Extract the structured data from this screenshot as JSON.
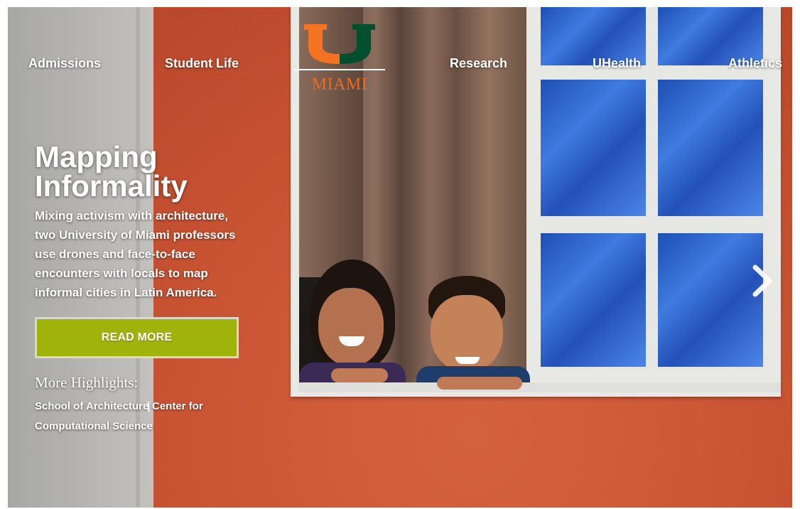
{
  "nav": {
    "left": [
      {
        "label": "Admissions"
      },
      {
        "label": "Student Life"
      }
    ],
    "right": [
      {
        "label": "Research"
      },
      {
        "label": "UHealth"
      },
      {
        "label": "Athletics"
      }
    ]
  },
  "logo": {
    "text": "MIAMI",
    "colors": {
      "orange": "#f47321",
      "green": "#005030",
      "wordmark": "#e86d1f"
    }
  },
  "feature": {
    "headline": "Mapping Informality",
    "description": "Mixing activism with architecture, two University of Miami professors use drones and face-to-face encounters with locals to map informal cities in Latin America.",
    "cta_label": "READ MORE",
    "cta_color": "#9fb30b"
  },
  "highlights": {
    "title": "More Highlights:",
    "separator": "|",
    "links": [
      {
        "label": "School of Architecture"
      },
      {
        "label": "Center for"
      },
      {
        "label": "Computational Science"
      }
    ]
  },
  "carousel": {
    "next_icon": "chevron-right-icon"
  }
}
